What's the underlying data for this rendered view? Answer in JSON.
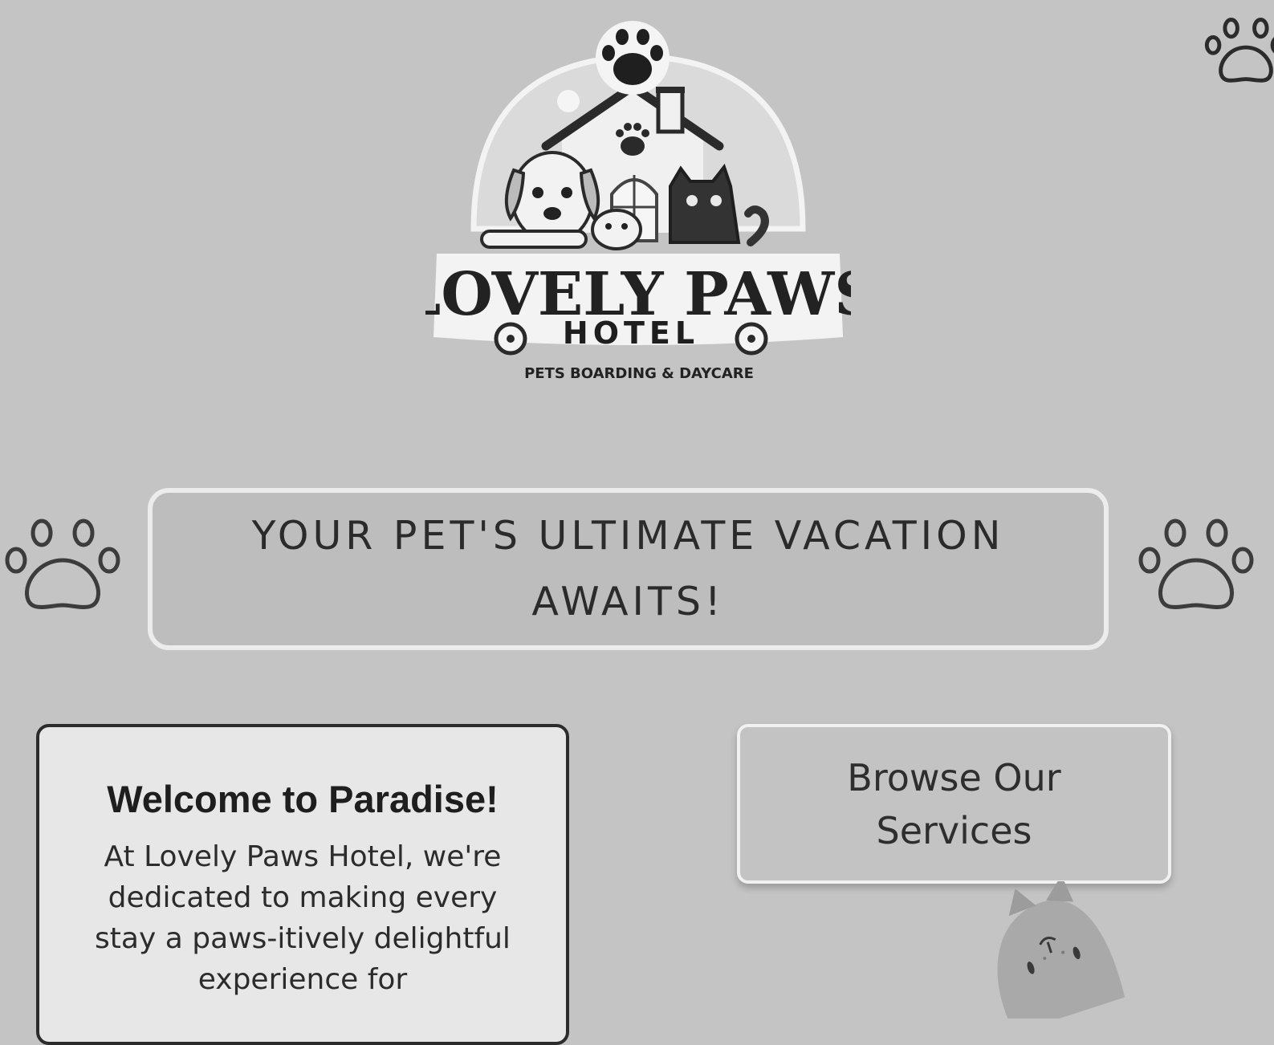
{
  "brand": {
    "logo_name": "LOVELY PAWS",
    "logo_sub": "HOTEL",
    "logo_tagline": "PETS BOARDING & DAYCARE"
  },
  "hero": {
    "tagline": "YOUR PET'S ULTIMATE VACATION AWAITS!"
  },
  "welcome": {
    "title": "Welcome to Paradise!",
    "body": "At Lovely Paws Hotel, we're dedicated to making every stay a paws-itively delightful experience for"
  },
  "actions": {
    "services_label": "Browse Our Services"
  },
  "icons": {
    "corner": "paw-print-icon",
    "left": "paw-print-icon",
    "right": "paw-print-icon",
    "mascot": "cat-icon"
  },
  "colors": {
    "background": "#c4c4c4",
    "card": "#e7e7e7",
    "text": "#2b2b2b"
  }
}
